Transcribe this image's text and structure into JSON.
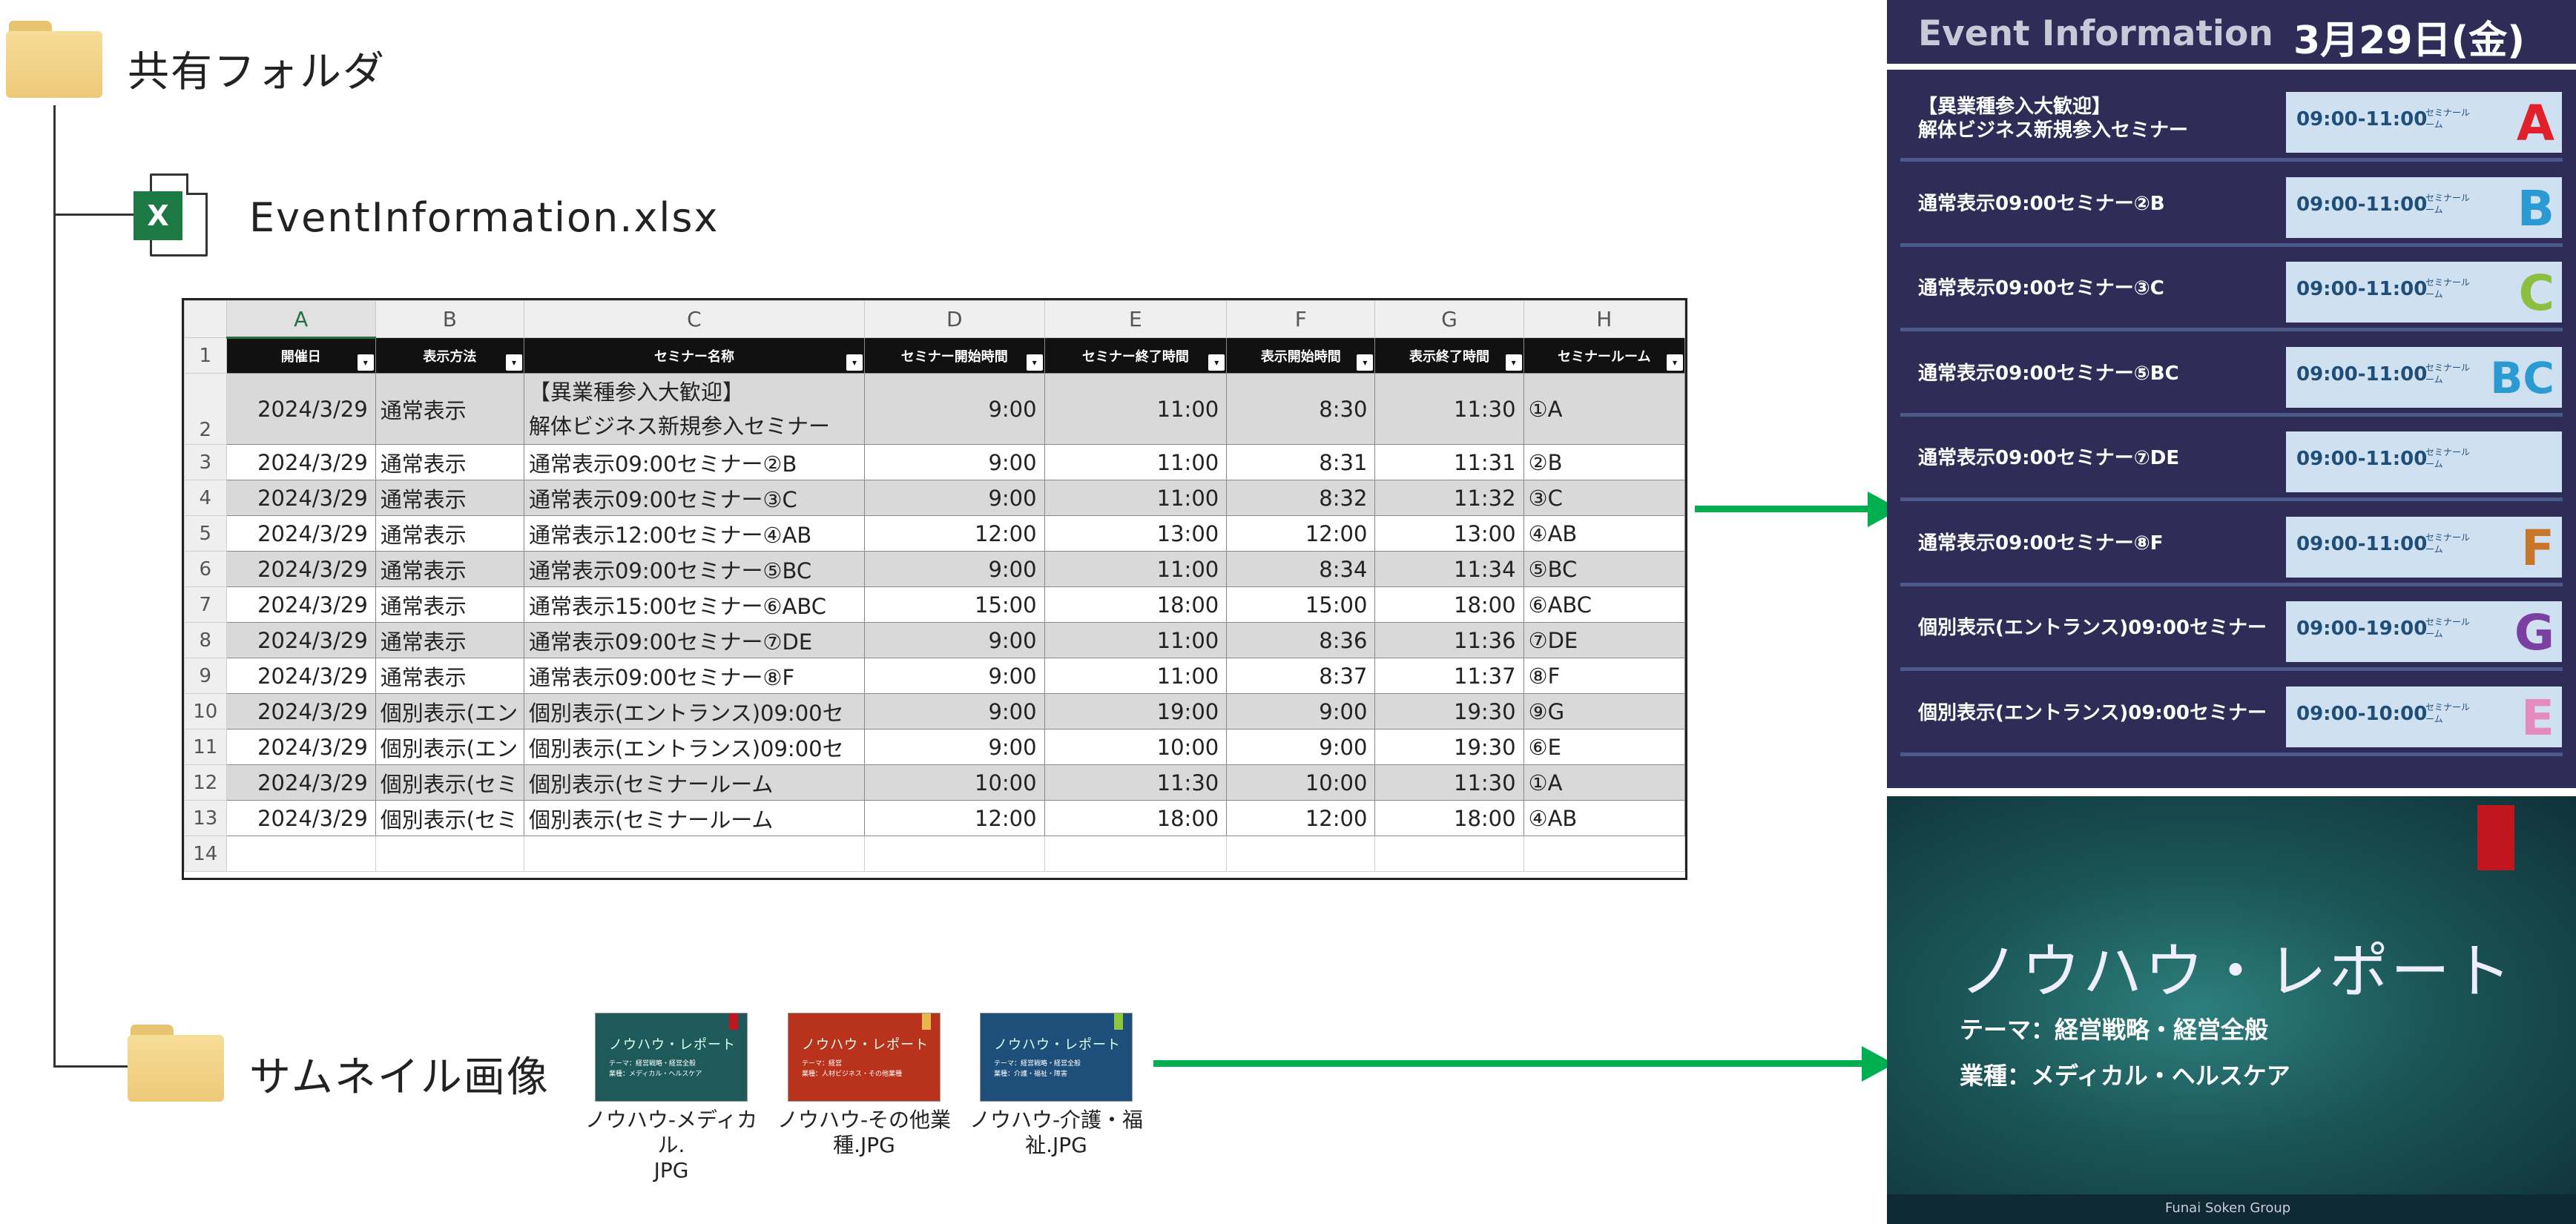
{
  "tree": {
    "root_folder": "共有フォルダ",
    "excel_file": "EventInformation.xlsx",
    "thumb_folder": "サムネイル画像"
  },
  "spreadsheet": {
    "column_letters": [
      "A",
      "B",
      "C",
      "D",
      "E",
      "F",
      "G",
      "H"
    ],
    "row_numbers": [
      "1",
      "2",
      "3",
      "4",
      "5",
      "6",
      "7",
      "8",
      "9",
      "10",
      "11",
      "12",
      "13",
      "14"
    ],
    "headers": [
      "開催日",
      "表示方法",
      "セミナー名称",
      "セミナー開始時間",
      "セミナー終了時間",
      "表示開始時間",
      "表示終了時間",
      "セミナールーム"
    ],
    "rows": [
      [
        "2024/3/29",
        "通常表示",
        "【異業種参入大歓迎】",
        "解体ビジネス新規参入セミナー",
        "9:00",
        "11:00",
        "8:30",
        "11:30",
        "①A"
      ],
      [
        "2024/3/29",
        "通常表示",
        "通常表示09:00セミナー②B",
        "",
        "9:00",
        "11:00",
        "8:31",
        "11:31",
        "②B"
      ],
      [
        "2024/3/29",
        "通常表示",
        "通常表示09:00セミナー③C",
        "",
        "9:00",
        "11:00",
        "8:32",
        "11:32",
        "③C"
      ],
      [
        "2024/3/29",
        "通常表示",
        "通常表示12:00セミナー④AB",
        "",
        "12:00",
        "13:00",
        "12:00",
        "13:00",
        "④AB"
      ],
      [
        "2024/3/29",
        "通常表示",
        "通常表示09:00セミナー⑤BC",
        "",
        "9:00",
        "11:00",
        "8:34",
        "11:34",
        "⑤BC"
      ],
      [
        "2024/3/29",
        "通常表示",
        "通常表示15:00セミナー⑥ABC",
        "",
        "15:00",
        "18:00",
        "15:00",
        "18:00",
        "⑥ABC"
      ],
      [
        "2024/3/29",
        "通常表示",
        "通常表示09:00セミナー⑦DE",
        "",
        "9:00",
        "11:00",
        "8:36",
        "11:36",
        "⑦DE"
      ],
      [
        "2024/3/29",
        "通常表示",
        "通常表示09:00セミナー⑧F",
        "",
        "9:00",
        "11:00",
        "8:37",
        "11:37",
        "⑧F"
      ],
      [
        "2024/3/29",
        "個別表示(エン",
        "個別表示(エントランス)09:00セ",
        "",
        "9:00",
        "19:00",
        "9:00",
        "19:30",
        "⑨G"
      ],
      [
        "2024/3/29",
        "個別表示(エン",
        "個別表示(エントランス)09:00セ",
        "",
        "9:00",
        "10:00",
        "9:00",
        "19:30",
        "⑥E"
      ],
      [
        "2024/3/29",
        "個別表示(セミ",
        "個別表示(セミナールーム",
        "",
        "10:00",
        "11:30",
        "10:00",
        "11:30",
        "①A"
      ],
      [
        "2024/3/29",
        "個別表示(セミ",
        "個別表示(セミナールーム",
        "",
        "12:00",
        "18:00",
        "12:00",
        "18:00",
        "④AB"
      ]
    ]
  },
  "thumbnails": [
    {
      "caption1": "ノウハウ-メディカル.",
      "caption2": "JPG",
      "title": "ノウハウ・レポート",
      "line1": "テーマ：経営戦略・経営全般",
      "line2": "業種：メディカル・ヘルスケア",
      "bg": "#1f5a5b",
      "flag": "#c0161d"
    },
    {
      "caption1": "ノウハウ-その他業",
      "caption2": "種.JPG",
      "title": "ノウハウ・レポート",
      "line1": "テーマ：経営",
      "line2": "業種：人材ビジネス・その他業種",
      "bg": "#b8321c",
      "flag": "#e8b84a"
    },
    {
      "caption1": "ノウハウ-介護・福",
      "caption2": "祉.JPG",
      "title": "ノウハウ・レポート",
      "line1": "テーマ：経営戦略・経営全般",
      "line2": "業種：介護・福祉・障害",
      "bg": "#1d4f7a",
      "flag": "#8cc63f"
    }
  ],
  "event_panel": {
    "title": "Event Information",
    "date": "3月29日(金)",
    "room_label": "セミナールーム",
    "rows": [
      {
        "name1": "【異業種参入大歓迎】",
        "name2": "解体ビジネス新規参入セミナー",
        "time": "09:00-11:00",
        "letter": "A",
        "color": "#e0202a"
      },
      {
        "name1": "通常表示09:00セミナー②B",
        "name2": "",
        "time": "09:00-11:00",
        "letter": "B",
        "color": "#2b9ad3"
      },
      {
        "name1": "通常表示09:00セミナー③C",
        "name2": "",
        "time": "09:00-11:00",
        "letter": "C",
        "color": "#8cbf3f"
      },
      {
        "name1": "通常表示09:00セミナー⑤BC",
        "name2": "",
        "time": "09:00-11:00",
        "letter": "BC",
        "color": "#2b9ad3"
      },
      {
        "name1": "通常表示09:00セミナー⑦DE",
        "name2": "",
        "time": "09:00-11:00",
        "letter": "",
        "color": "#2b9ad3"
      },
      {
        "name1": "通常表示09:00セミナー⑧F",
        "name2": "",
        "time": "09:00-11:00",
        "letter": "F",
        "color": "#c8762a"
      },
      {
        "name1": "個別表示(エントランス)09:00セミナー",
        "name2": "",
        "time": "09:00-19:00",
        "letter": "G",
        "color": "#7a3fa0"
      },
      {
        "name1": "個別表示(エントランス)09:00セミナー",
        "name2": "",
        "time": "09:00-10:00",
        "letter": "E",
        "color": "#e58ac0"
      }
    ]
  },
  "knowhow": {
    "title": "ノウハウ・レポート",
    "line1": "テーマ：経営戦略・経営全般",
    "line2": "業種：メディカル・ヘルスケア",
    "footer": "Funai Soken Group"
  },
  "colors": {
    "arrow": "#00b050",
    "panel_bg": "#2f2d57",
    "excel_green": "#1d7a44"
  }
}
